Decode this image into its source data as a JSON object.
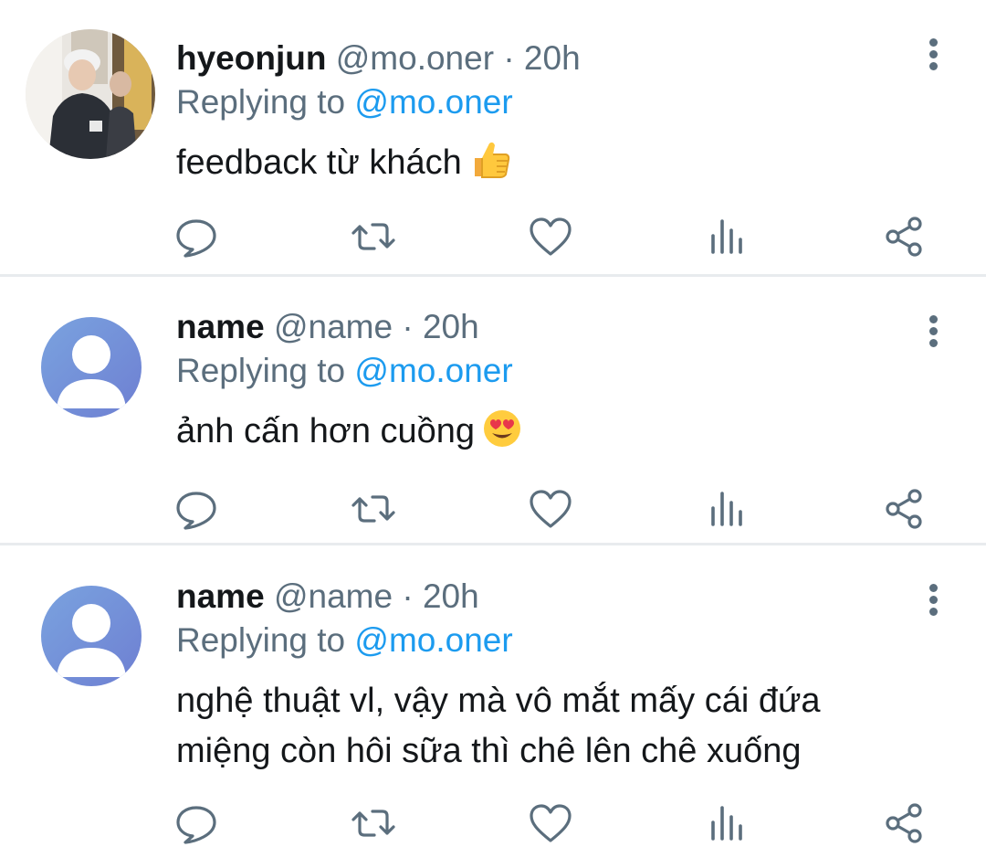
{
  "tweets": [
    {
      "display_name": "hyeonjun",
      "handle": "@mo.oner",
      "separator": "·",
      "time": "20h",
      "replying_prefix": "Replying to ",
      "replying_to": "@mo.oner",
      "text": "feedback từ khách",
      "emoji": "thumbs-up",
      "avatar": "photo"
    },
    {
      "display_name": "name",
      "handle": "@name",
      "separator": "·",
      "time": "20h",
      "replying_prefix": "Replying to ",
      "replying_to": "@mo.oner",
      "text": "ảnh cấn hơn cuồng",
      "emoji": "heart-eyes",
      "avatar": "default"
    },
    {
      "display_name": "name",
      "handle": "@name",
      "separator": "·",
      "time": "20h",
      "replying_prefix": "Replying to ",
      "replying_to": "@mo.oner",
      "text_line1": "nghệ thuật vl, vậy mà vô mắt mấy cái đứa",
      "text_line2": "miệng còn hôi sữa thì chê lên chê xuống",
      "avatar": "default"
    }
  ],
  "icons": [
    "reply-icon",
    "retweet-icon",
    "like-icon",
    "views-icon",
    "share-icon",
    "more-icon"
  ],
  "colors": {
    "mention": "#1c9bef",
    "secondary": "#5b6e7d",
    "primary_text": "#14171a",
    "divider": "#e8ebee"
  }
}
